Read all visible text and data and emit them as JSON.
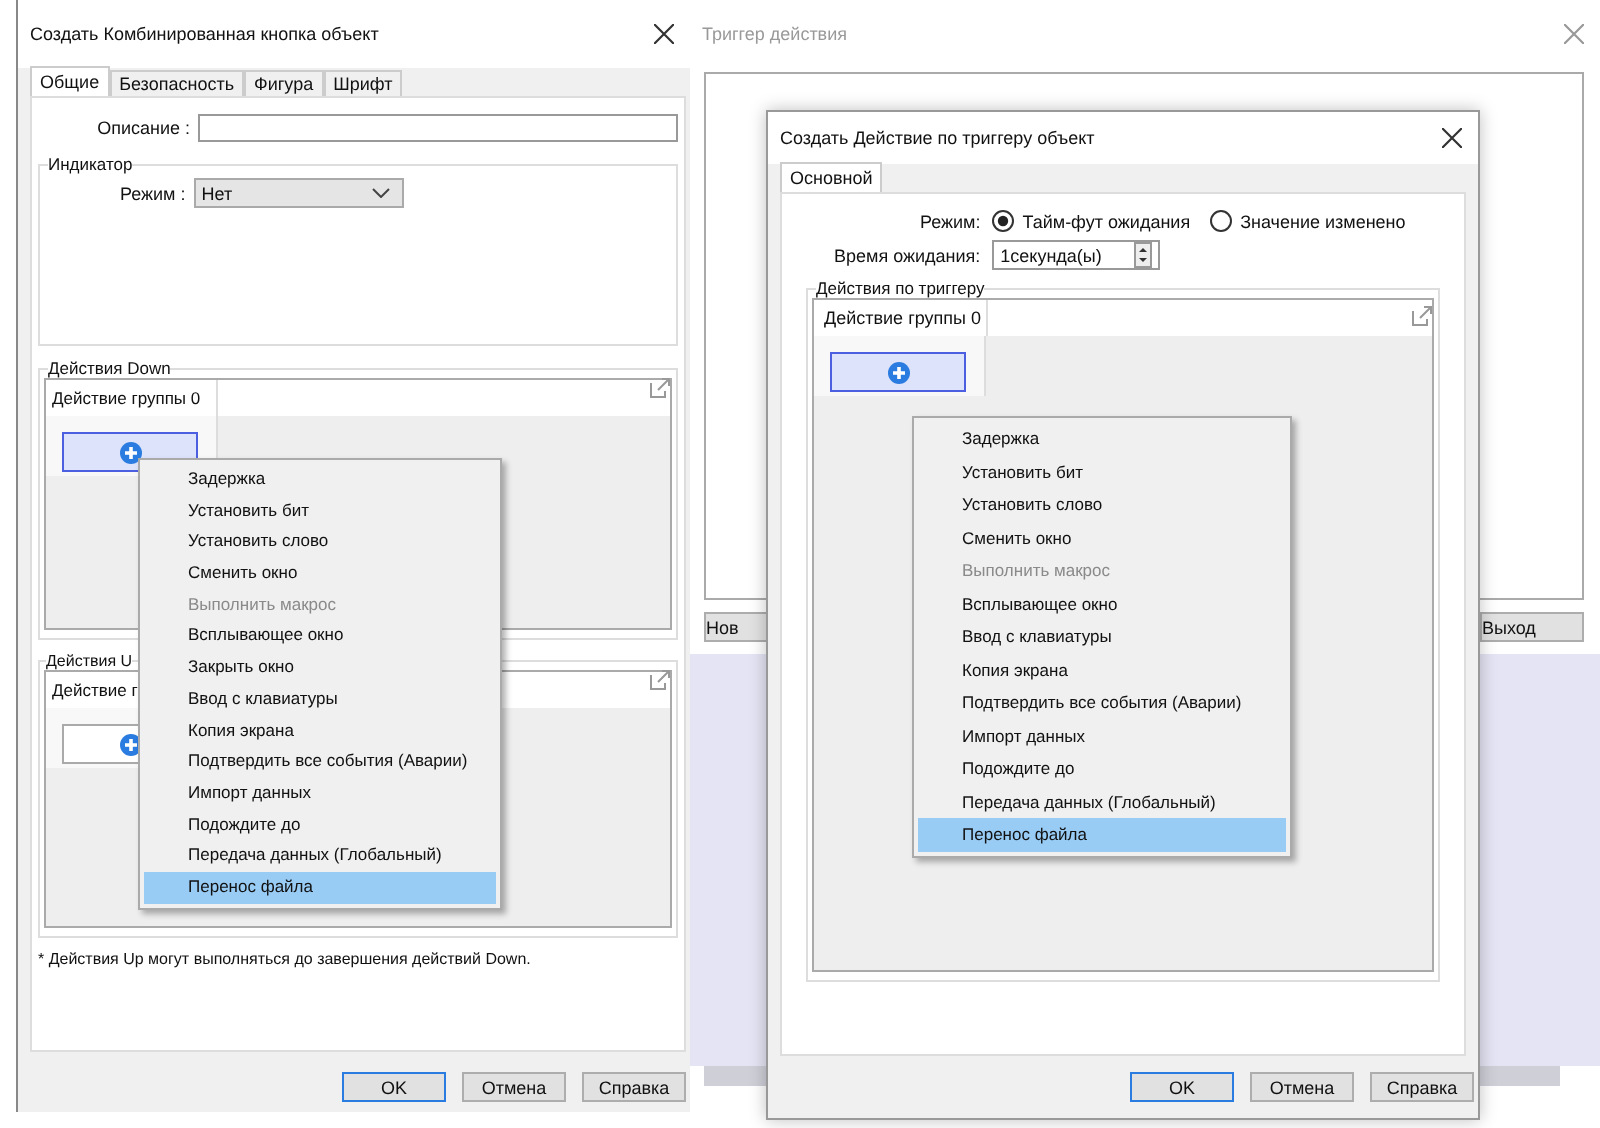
{
  "trigger_window": {
    "title": "Триггер действия",
    "active": false,
    "buttons": [
      "Нов",
      "Выход"
    ]
  },
  "main_dialog": {
    "title": "Создать Комбинированная кнопка объект",
    "tabs": [
      {
        "label": "Общие",
        "selected": true
      },
      {
        "label": "Безопасность",
        "selected": false
      },
      {
        "label": "Фигура",
        "selected": false
      },
      {
        "label": "Шрифт",
        "selected": false
      }
    ],
    "description_label": "Описание :",
    "indicator": {
      "title": "Индикатор",
      "mode_label": "Режим :",
      "mode_value": "Нет"
    },
    "down_actions": {
      "title": "Действия Down",
      "column": "Действие группы 0",
      "add_selected": true
    },
    "up_actions": {
      "title": "Действия U",
      "column": "Действие г",
      "add_selected": false
    },
    "footnote": "* Действия Up могут выполняться до завершения действий Down.",
    "buttons": [
      {
        "label": "OK",
        "default": true
      },
      {
        "label": "Отмена",
        "default": false
      },
      {
        "label": "Справка",
        "default": false
      }
    ]
  },
  "down_menu": {
    "items": [
      {
        "label": "Задержка",
        "disabled": false,
        "selected": false
      },
      {
        "label": "Установить бит",
        "disabled": false,
        "selected": false
      },
      {
        "label": "Установить слово",
        "disabled": false,
        "selected": false
      },
      {
        "label": "Сменить окно",
        "disabled": false,
        "selected": false
      },
      {
        "label": "Выполнить макрос",
        "disabled": true,
        "selected": false
      },
      {
        "label": "Всплывающее окно",
        "disabled": false,
        "selected": false
      },
      {
        "label": "Закрыть окно",
        "disabled": false,
        "selected": false
      },
      {
        "label": "Ввод с клавиатуры",
        "disabled": false,
        "selected": false
      },
      {
        "label": "Копия экрана",
        "disabled": false,
        "selected": false
      },
      {
        "label": "Подтвердить все события  (Аварии)",
        "disabled": false,
        "selected": false
      },
      {
        "label": "Импорт данных",
        "disabled": false,
        "selected": false
      },
      {
        "label": "Подождите до",
        "disabled": false,
        "selected": false
      },
      {
        "label": "Передача данных (Глобальный)",
        "disabled": false,
        "selected": false
      },
      {
        "label": "Перенос файла",
        "disabled": false,
        "selected": true
      }
    ]
  },
  "trigger_dialog": {
    "title": "Создать Действие по триггеру объект",
    "tabs": [
      {
        "label": "Основной",
        "selected": true
      }
    ],
    "mode_label": "Режим:",
    "options": [
      {
        "label": "Тайм-фут ожидания",
        "selected": true
      },
      {
        "label": "Значение изменено",
        "selected": false
      }
    ],
    "wait_label": "Время ожидания:",
    "wait_value": "1секунда(ы)",
    "group_title": "Действия по триггеру",
    "column": "Действие группы 0",
    "add_selected": true,
    "buttons": [
      {
        "label": "OK",
        "default": true
      },
      {
        "label": "Отмена",
        "default": false
      },
      {
        "label": "Справка",
        "default": false
      }
    ]
  },
  "trigger_menu": {
    "items": [
      {
        "label": "Задержка",
        "disabled": false,
        "selected": false
      },
      {
        "label": "Установить бит",
        "disabled": false,
        "selected": false
      },
      {
        "label": "Установить слово",
        "disabled": false,
        "selected": false
      },
      {
        "label": "Сменить окно",
        "disabled": false,
        "selected": false
      },
      {
        "label": "Выполнить макрос",
        "disabled": true,
        "selected": false
      },
      {
        "label": "Всплывающее окно",
        "disabled": false,
        "selected": false
      },
      {
        "label": "Ввод с клавиатуры",
        "disabled": false,
        "selected": false
      },
      {
        "label": "Копия экрана",
        "disabled": false,
        "selected": false
      },
      {
        "label": "Подтвердить все события  (Аварии)",
        "disabled": false,
        "selected": false
      },
      {
        "label": "Импорт данных",
        "disabled": false,
        "selected": false
      },
      {
        "label": "Подождите до",
        "disabled": false,
        "selected": false
      },
      {
        "label": "Передача данных (Глобальный)",
        "disabled": false,
        "selected": false
      },
      {
        "label": "Перенос файла",
        "disabled": false,
        "selected": true
      }
    ]
  }
}
